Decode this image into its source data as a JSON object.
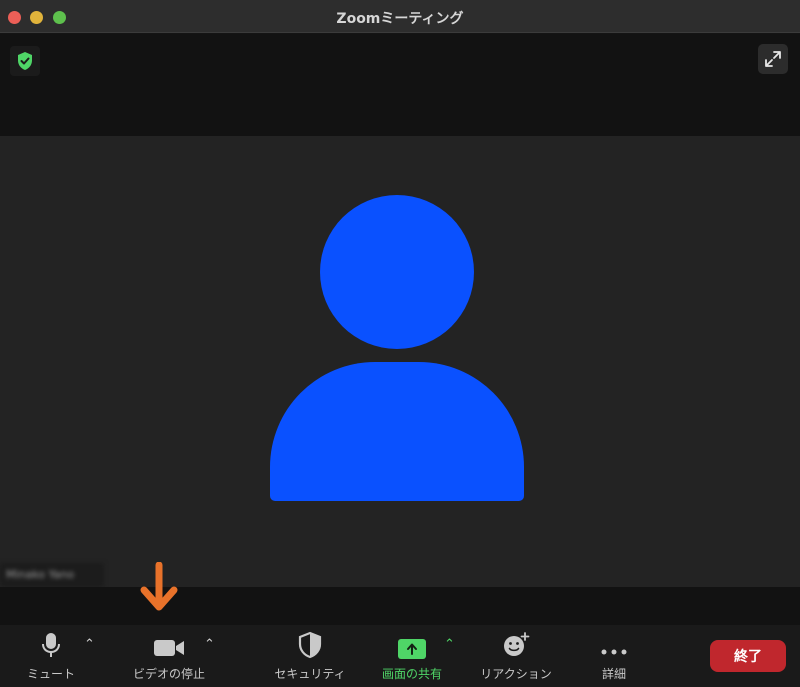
{
  "window": {
    "title": "Zoomミーティング"
  },
  "video": {
    "participant_name": "Minako Yano",
    "avatar_color": "#0a51ff"
  },
  "toolbar": {
    "mute_label": "ミュート",
    "stop_video_label": "ビデオの停止",
    "security_label": "セキュリティ",
    "share_screen_label": "画面の共有",
    "reactions_label": "リアクション",
    "more_label": "詳細",
    "end_label": "終了"
  },
  "colors": {
    "accent_green": "#4fd567",
    "end_red": "#c0272d",
    "annotation_orange": "#e8722a"
  },
  "icons": [
    "shield-check-icon",
    "expand-icon",
    "microphone-icon",
    "video-camera-icon",
    "security-shield-icon",
    "share-screen-icon",
    "reaction-smiley-icon",
    "more-dots-icon",
    "down-arrow-annotation"
  ]
}
